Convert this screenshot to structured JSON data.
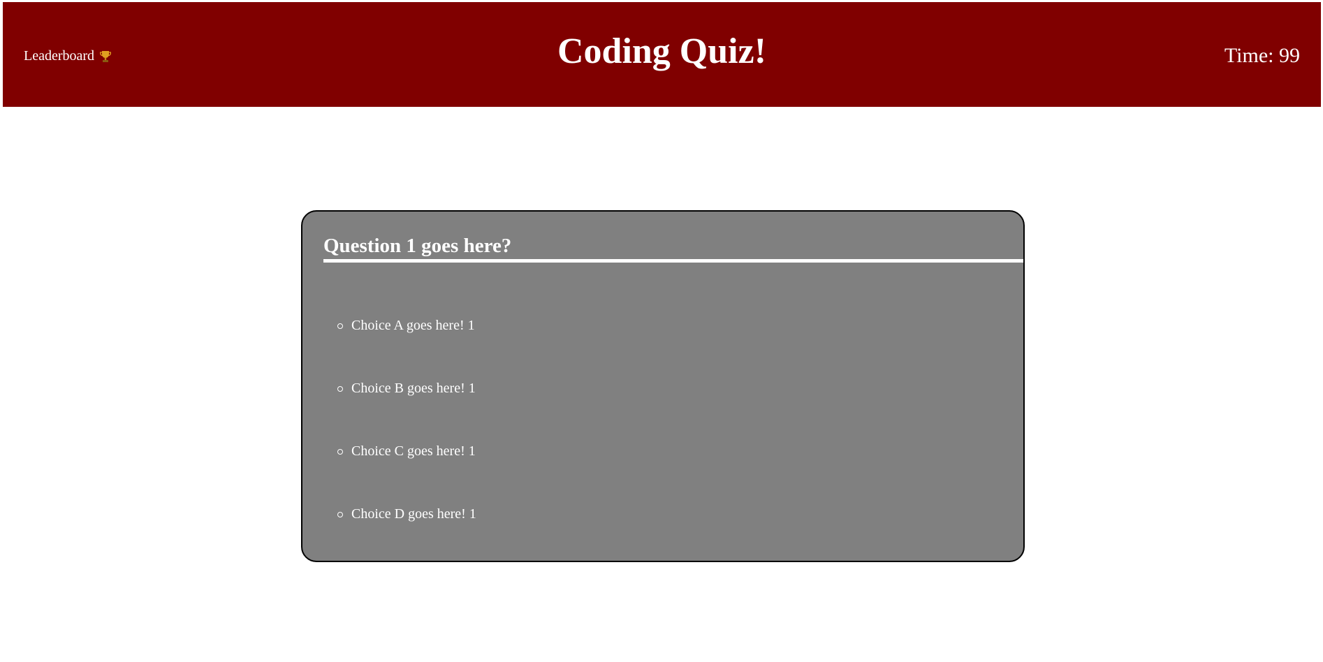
{
  "header": {
    "leaderboard_label": "Leaderboard",
    "leaderboard_icon": "trophy-icon",
    "title": "Coding Quiz!",
    "timer": "Time: 99",
    "background": "#800000"
  },
  "quiz": {
    "question": "Question 1 goes here?",
    "choices": [
      {
        "label": "Choice A goes here! 1"
      },
      {
        "label": "Choice B goes here! 1"
      },
      {
        "label": "Choice C goes here! 1"
      },
      {
        "label": "Choice D goes here! 1"
      }
    ],
    "card_color": "#808080"
  }
}
